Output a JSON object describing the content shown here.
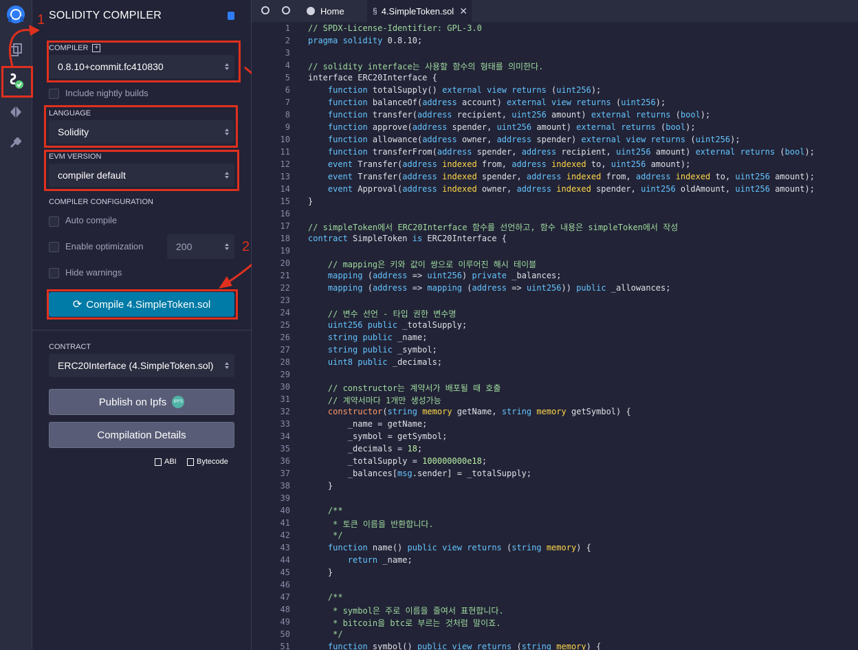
{
  "panel": {
    "title": "SOLIDITY COMPILER",
    "compiler_label": "COMPILER",
    "compiler_value": "0.8.10+commit.fc410830",
    "nightly_label": "Include nightly builds",
    "language_label": "LANGUAGE",
    "language_value": "Solidity",
    "evm_label": "EVM VERSION",
    "evm_value": "compiler default",
    "config_label": "COMPILER CONFIGURATION",
    "auto_compile": "Auto compile",
    "enable_opt": "Enable optimization",
    "runs_value": "200",
    "hide_warnings": "Hide warnings",
    "compile_button": "Compile 4.SimpleToken.sol",
    "contract_label": "CONTRACT",
    "contract_value": "ERC20Interface (4.SimpleToken.sol)",
    "publish_button": "Publish on Ipfs",
    "ipfs_badge": "IPFS",
    "details_button": "Compilation Details",
    "abi_link": "ABI",
    "bytecode_link": "Bytecode"
  },
  "annotations": {
    "step1": "1",
    "step2": "2"
  },
  "tabs": [
    {
      "label": "Home"
    },
    {
      "label": "4.SimpleToken.sol"
    }
  ],
  "code": [
    [
      [
        "// SPDX-License-Identifier: GPL-3.0",
        "comment"
      ]
    ],
    [
      [
        "pragma",
        "kw"
      ],
      [
        " solidity ",
        "kw"
      ],
      [
        "0.8.10",
        "plain"
      ],
      [
        ";",
        "plain"
      ]
    ],
    [],
    [
      [
        "// solidity interface는 사용할 함수의 형태를 의미한다.",
        "comment"
      ]
    ],
    [
      [
        "interface",
        "plain"
      ],
      [
        " ERC20Interface {",
        "plain"
      ]
    ],
    [
      [
        "    function",
        "kw"
      ],
      [
        " totalSupply() ",
        "plain"
      ],
      [
        "external view returns",
        "kw"
      ],
      [
        " (",
        "plain"
      ],
      [
        "uint256",
        "type"
      ],
      [
        ");",
        "plain"
      ]
    ],
    [
      [
        "    function",
        "kw"
      ],
      [
        " balanceOf(",
        "plain"
      ],
      [
        "address",
        "type"
      ],
      [
        " account) ",
        "plain"
      ],
      [
        "external view returns",
        "kw"
      ],
      [
        " (",
        "plain"
      ],
      [
        "uint256",
        "type"
      ],
      [
        ");",
        "plain"
      ]
    ],
    [
      [
        "    function",
        "kw"
      ],
      [
        " transfer(",
        "plain"
      ],
      [
        "address",
        "type"
      ],
      [
        " recipient, ",
        "plain"
      ],
      [
        "uint256",
        "type"
      ],
      [
        " amount) ",
        "plain"
      ],
      [
        "external returns",
        "kw"
      ],
      [
        " (",
        "plain"
      ],
      [
        "bool",
        "type"
      ],
      [
        ");",
        "plain"
      ]
    ],
    [
      [
        "    function",
        "kw"
      ],
      [
        " approve(",
        "plain"
      ],
      [
        "address",
        "type"
      ],
      [
        " spender, ",
        "plain"
      ],
      [
        "uint256",
        "type"
      ],
      [
        " amount) ",
        "plain"
      ],
      [
        "external returns",
        "kw"
      ],
      [
        " (",
        "plain"
      ],
      [
        "bool",
        "type"
      ],
      [
        ");",
        "plain"
      ]
    ],
    [
      [
        "    function",
        "kw"
      ],
      [
        " allowance(",
        "plain"
      ],
      [
        "address",
        "type"
      ],
      [
        " owner, ",
        "plain"
      ],
      [
        "address",
        "type"
      ],
      [
        " spender) ",
        "plain"
      ],
      [
        "external view returns",
        "kw"
      ],
      [
        " (",
        "plain"
      ],
      [
        "uint256",
        "type"
      ],
      [
        ");",
        "plain"
      ]
    ],
    [
      [
        "    function",
        "kw"
      ],
      [
        " transferFrom(",
        "plain"
      ],
      [
        "address",
        "type"
      ],
      [
        " spender, ",
        "plain"
      ],
      [
        "address",
        "type"
      ],
      [
        " recipient, ",
        "plain"
      ],
      [
        "uint256",
        "type"
      ],
      [
        " amount) ",
        "plain"
      ],
      [
        "external returns",
        "kw"
      ],
      [
        " (",
        "plain"
      ],
      [
        "bool",
        "type"
      ],
      [
        ");",
        "plain"
      ]
    ],
    [
      [
        "    event",
        "kw"
      ],
      [
        " Transfer(",
        "plain"
      ],
      [
        "address",
        "type"
      ],
      [
        " ",
        "plain"
      ],
      [
        "indexed",
        "mod"
      ],
      [
        " from, ",
        "plain"
      ],
      [
        "address",
        "type"
      ],
      [
        " ",
        "plain"
      ],
      [
        "indexed",
        "mod"
      ],
      [
        " to, ",
        "plain"
      ],
      [
        "uint256",
        "type"
      ],
      [
        " amount);",
        "plain"
      ]
    ],
    [
      [
        "    event",
        "kw"
      ],
      [
        " Transfer(",
        "plain"
      ],
      [
        "address",
        "type"
      ],
      [
        " ",
        "plain"
      ],
      [
        "indexed",
        "mod"
      ],
      [
        " spender, ",
        "plain"
      ],
      [
        "address",
        "type"
      ],
      [
        " ",
        "plain"
      ],
      [
        "indexed",
        "mod"
      ],
      [
        " from, ",
        "plain"
      ],
      [
        "address",
        "type"
      ],
      [
        " ",
        "plain"
      ],
      [
        "indexed",
        "mod"
      ],
      [
        " to, ",
        "plain"
      ],
      [
        "uint256",
        "type"
      ],
      [
        " amount);",
        "plain"
      ]
    ],
    [
      [
        "    event",
        "kw"
      ],
      [
        " Approval(",
        "plain"
      ],
      [
        "address",
        "type"
      ],
      [
        " ",
        "plain"
      ],
      [
        "indexed",
        "mod"
      ],
      [
        " owner, ",
        "plain"
      ],
      [
        "address",
        "type"
      ],
      [
        " ",
        "plain"
      ],
      [
        "indexed",
        "mod"
      ],
      [
        " spender, ",
        "plain"
      ],
      [
        "uint256",
        "type"
      ],
      [
        " oldAmount, ",
        "plain"
      ],
      [
        "uint256",
        "type"
      ],
      [
        " amount);",
        "plain"
      ]
    ],
    [
      [
        "}",
        "plain"
      ]
    ],
    [],
    [
      [
        "// simpleToken에서 ERC20Interface 함수를 선언하고, 함수 내용은 simpleToken에서 작성",
        "comment"
      ]
    ],
    [
      [
        "contract",
        "kw"
      ],
      [
        " SimpleToken ",
        "plain"
      ],
      [
        "is",
        "kw"
      ],
      [
        " ERC20Interface {",
        "plain"
      ]
    ],
    [],
    [
      [
        "    // mapping은 키와 값이 쌍으로 이루어진 해시 테이블",
        "comment"
      ]
    ],
    [
      [
        "    mapping",
        "kw"
      ],
      [
        " (",
        "plain"
      ],
      [
        "address",
        "type"
      ],
      [
        " => ",
        "plain"
      ],
      [
        "uint256",
        "type"
      ],
      [
        ") ",
        "plain"
      ],
      [
        "private",
        "kw"
      ],
      [
        " _balances;",
        "plain"
      ]
    ],
    [
      [
        "    mapping",
        "kw"
      ],
      [
        " (",
        "plain"
      ],
      [
        "address",
        "type"
      ],
      [
        " => ",
        "plain"
      ],
      [
        "mapping",
        "kw"
      ],
      [
        " (",
        "plain"
      ],
      [
        "address",
        "type"
      ],
      [
        " => ",
        "plain"
      ],
      [
        "uint256",
        "type"
      ],
      [
        ")) ",
        "plain"
      ],
      [
        "public",
        "kw"
      ],
      [
        " _allowances;",
        "plain"
      ]
    ],
    [],
    [
      [
        "    // 변수 선언 - 타입 권한 변수명",
        "comment"
      ]
    ],
    [
      [
        "    uint256",
        "type"
      ],
      [
        " ",
        "plain"
      ],
      [
        "public",
        "kw"
      ],
      [
        " _totalSupply;",
        "plain"
      ]
    ],
    [
      [
        "    string",
        "type"
      ],
      [
        " ",
        "plain"
      ],
      [
        "public",
        "kw"
      ],
      [
        " _name;",
        "plain"
      ]
    ],
    [
      [
        "    string",
        "type"
      ],
      [
        " ",
        "plain"
      ],
      [
        "public",
        "kw"
      ],
      [
        " _symbol;",
        "plain"
      ]
    ],
    [
      [
        "    uint8",
        "type"
      ],
      [
        " ",
        "plain"
      ],
      [
        "public",
        "kw"
      ],
      [
        " _decimals;",
        "plain"
      ]
    ],
    [],
    [
      [
        "    // constructor는 계약서가 배포될 때 호출",
        "comment"
      ]
    ],
    [
      [
        "    // 계약서마다 1개만 생성가능",
        "comment"
      ]
    ],
    [
      [
        "    constructor",
        "ctor"
      ],
      [
        "(",
        "plain"
      ],
      [
        "string",
        "type"
      ],
      [
        " ",
        "plain"
      ],
      [
        "memory",
        "mod"
      ],
      [
        " getName, ",
        "plain"
      ],
      [
        "string",
        "type"
      ],
      [
        " ",
        "plain"
      ],
      [
        "memory",
        "mod"
      ],
      [
        " getSymbol) {",
        "plain"
      ]
    ],
    [
      [
        "        _name = getName;",
        "plain"
      ]
    ],
    [
      [
        "        _symbol = getSymbol;",
        "plain"
      ]
    ],
    [
      [
        "        _decimals = ",
        "plain"
      ],
      [
        "18",
        "num"
      ],
      [
        ";",
        "plain"
      ]
    ],
    [
      [
        "        _totalSupply = ",
        "plain"
      ],
      [
        "100000000e18",
        "num"
      ],
      [
        ";",
        "plain"
      ]
    ],
    [
      [
        "        _balances[",
        "plain"
      ],
      [
        "msg",
        "type"
      ],
      [
        ".sender] = _totalSupply;",
        "plain"
      ]
    ],
    [
      [
        "    }",
        "plain"
      ]
    ],
    [],
    [
      [
        "    /**",
        "comment"
      ]
    ],
    [
      [
        "     * 토큰 이름을 반환합니다.",
        "comment"
      ]
    ],
    [
      [
        "     */",
        "comment"
      ]
    ],
    [
      [
        "    function",
        "kw"
      ],
      [
        " name() ",
        "plain"
      ],
      [
        "public view returns",
        "kw"
      ],
      [
        " (",
        "plain"
      ],
      [
        "string",
        "type"
      ],
      [
        " ",
        "plain"
      ],
      [
        "memory",
        "mod"
      ],
      [
        ") {",
        "plain"
      ]
    ],
    [
      [
        "        return",
        "kw"
      ],
      [
        " _name;",
        "plain"
      ]
    ],
    [
      [
        "    }",
        "plain"
      ]
    ],
    [],
    [
      [
        "    /**",
        "comment"
      ]
    ],
    [
      [
        "     * symbol은 주로 이름을 줄여서 표현합니다.",
        "comment"
      ]
    ],
    [
      [
        "     * bitcoin을 btc로 부르는 것처럼 말이죠.",
        "comment"
      ]
    ],
    [
      [
        "     */",
        "comment"
      ]
    ],
    [
      [
        "    function",
        "kw"
      ],
      [
        " symbol() ",
        "plain"
      ],
      [
        "public view returns",
        "kw"
      ],
      [
        " (",
        "plain"
      ],
      [
        "string",
        "type"
      ],
      [
        " ",
        "plain"
      ],
      [
        "memory",
        "mod"
      ],
      [
        ") {",
        "plain"
      ]
    ]
  ],
  "colors": {
    "comment": "#9fdb9f",
    "kw": "#64c4ff",
    "type": "#64c4ff",
    "mod": "#ffd84a",
    "ctor": "#ff9a6a",
    "num": "#b9f2a6",
    "plain": "#e0e0e8",
    "accent": "#007aa6",
    "annotation": "#e0301e"
  }
}
